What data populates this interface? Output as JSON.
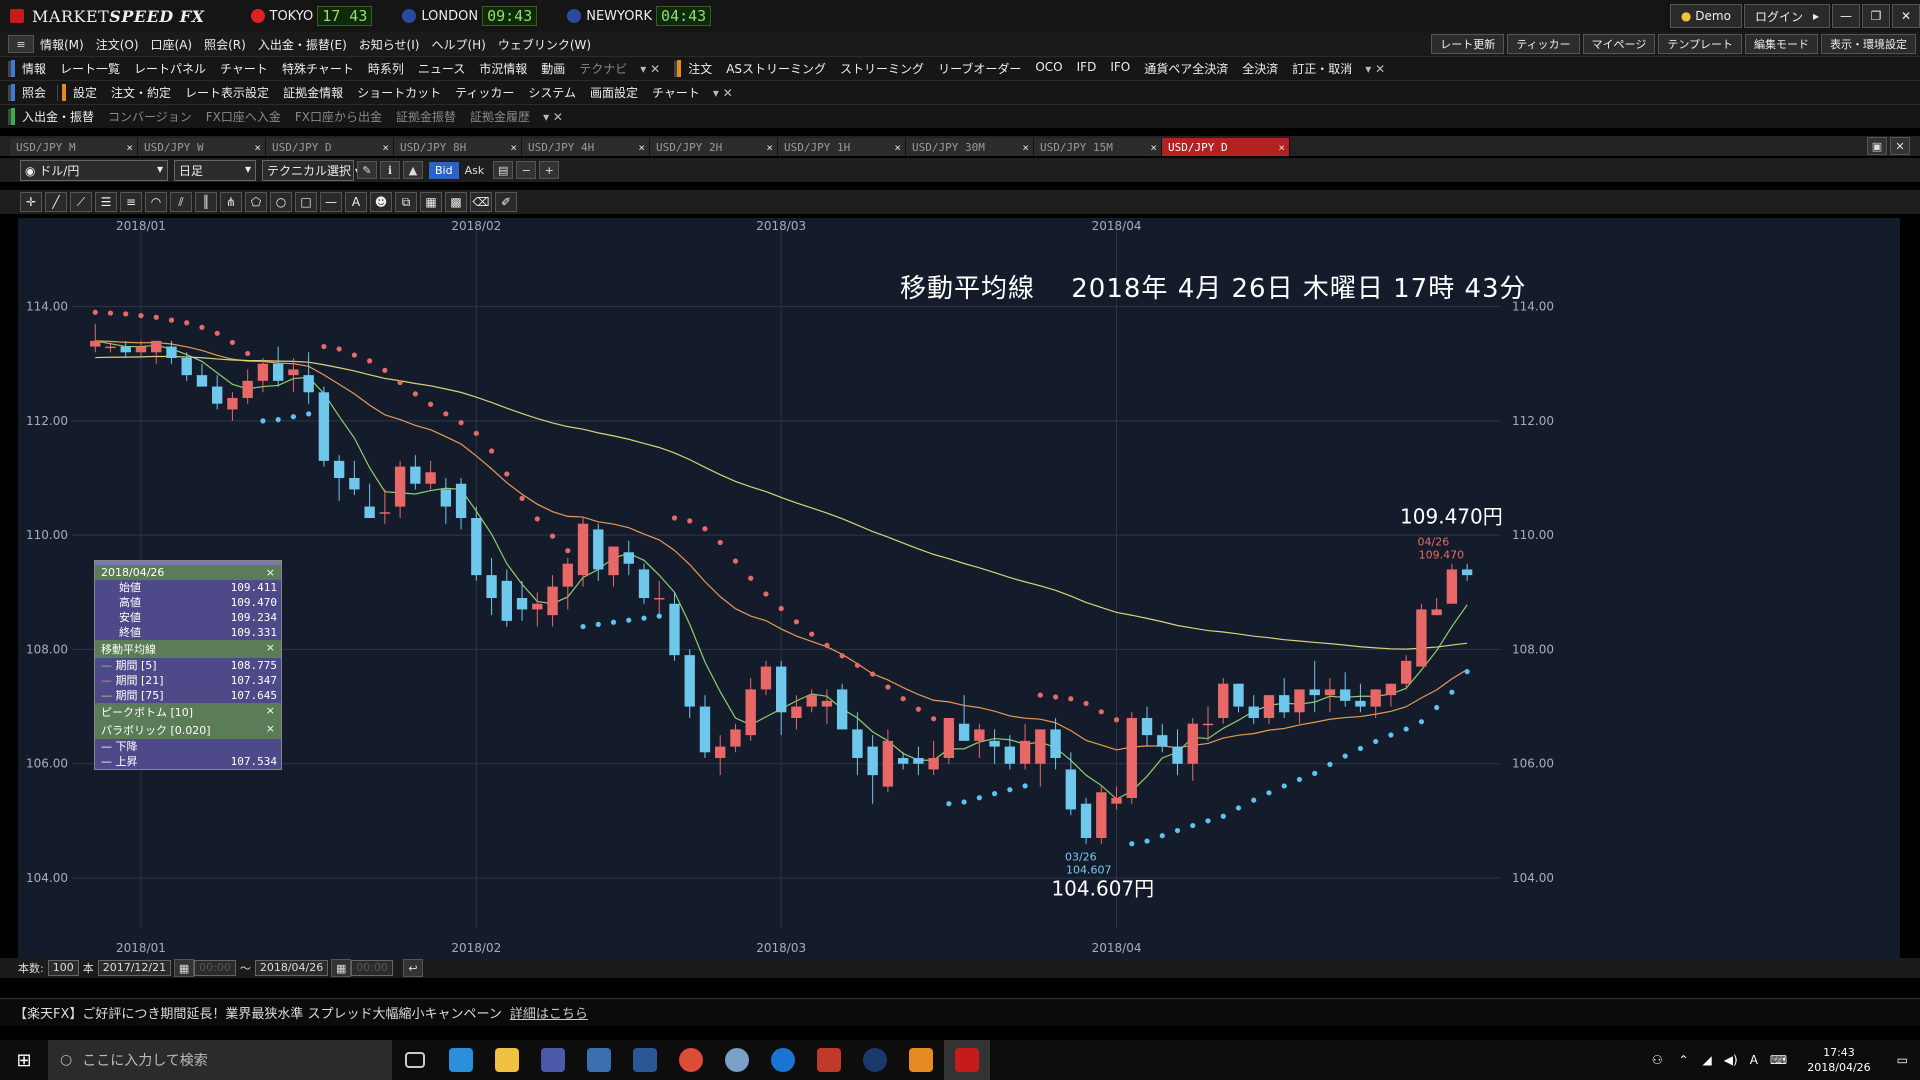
{
  "app": {
    "brand_a": "MARKET",
    "brand_b": "SPEED FX",
    "demo": "Demo",
    "login": "ログイン"
  },
  "clocks": [
    {
      "name": "TOKYO",
      "time": "17 43",
      "flag": "#d22"
    },
    {
      "name": "LONDON",
      "time": "09:43",
      "flag": "#2a4aa0"
    },
    {
      "name": "NEWYORK",
      "time": "04:43",
      "flag": "#2a4aa0"
    }
  ],
  "menu": [
    "情報(M)",
    "注文(O)",
    "口座(A)",
    "照会(R)",
    "入出金・振替(E)",
    "お知らせ(I)",
    "ヘルプ(H)",
    "ウェブリンク(W)"
  ],
  "menu_right": [
    "レート更新",
    "ティッカー",
    "マイページ",
    "テンプレート",
    "編集モード",
    "表示・環境設定"
  ],
  "toolbar1": {
    "section": "情報",
    "items": [
      "レート一覧",
      "レートパネル",
      "チャート",
      "特殊チャート",
      "時系列",
      "ニュース",
      "市況情報",
      "動画",
      "テクナビ"
    ],
    "order_section": "注文",
    "order_items": [
      "ASストリーミング",
      "ストリーミング",
      "リーブオーダー",
      "OCO",
      "IFD",
      "IFO",
      "通貨ペア全決済",
      "全決済",
      "訂正・取消"
    ]
  },
  "toolbar2": {
    "section": "照会",
    "section2": "設定",
    "items": [
      "注文・約定",
      "レート表示設定",
      "証拠金情報",
      "ショートカット",
      "ティッカー",
      "システム",
      "画面設定",
      "チャート"
    ]
  },
  "toolbar3": {
    "section": "入出金・振替",
    "items": [
      "コンバージョン",
      "FX口座へ入金",
      "FX口座から出金",
      "証拠金振替",
      "証拠金履歴"
    ]
  },
  "tabs": [
    "USD/JPY M",
    "USD/JPY W",
    "USD/JPY D",
    "USD/JPY 8H",
    "USD/JPY 4H",
    "USD/JPY 2H",
    "USD/JPY 1H",
    "USD/JPY 30M",
    "USD/JPY 15M",
    "USD/JPY D"
  ],
  "chart_controls": {
    "pair": "ドル/円",
    "period": "日足",
    "tech": "テクニカル選択",
    "bid": "Bid",
    "ask": "Ask"
  },
  "overlay_title": "移動平均線　 2018年 4月 26日 木曜日 17時 43分",
  "info_panel": {
    "date": "2018/04/26",
    "ohlc": [
      {
        "k": "始値",
        "v": "109.411"
      },
      {
        "k": "高値",
        "v": "109.470"
      },
      {
        "k": "安値",
        "v": "109.234"
      },
      {
        "k": "終値",
        "v": "109.331"
      }
    ],
    "ma_header": "移動平均線",
    "ma": [
      {
        "k": "期間 [5]",
        "v": "108.775"
      },
      {
        "k": "期間 [21]",
        "v": "107.347"
      },
      {
        "k": "期間 [75]",
        "v": "107.645"
      }
    ],
    "peak_header": "ピークボトム [10]",
    "sar_header": "パラボリック [0.020]",
    "sar": [
      {
        "k": "下降",
        "v": ""
      },
      {
        "k": "上昇",
        "v": "107.534"
      }
    ]
  },
  "bottom": {
    "count_label": "本数:",
    "count": "100",
    "unit": "本",
    "from": "2017/12/21",
    "from_time": "00:00",
    "tilde": "〜",
    "to": "2018/04/26",
    "to_time": "00:00"
  },
  "news": {
    "text": "【楽天FX】ご好評につき期間延長！業界最狭水準 スプレッド大幅縮小キャンペーン",
    "link": "詳細はこちら"
  },
  "taskbar": {
    "search": "ここに入力して検索",
    "time": "17:43",
    "date": "2018/04/26"
  },
  "chart_data": {
    "type": "candlestick",
    "instrument": "USD/JPY",
    "timeframe": "daily",
    "ylim": [
      103.3,
      115.2
    ],
    "yticks": [
      "104.00",
      "106.00",
      "108.00",
      "110.00",
      "112.00",
      "114.00"
    ],
    "month_labels": [
      {
        "label": "2018/01",
        "index": 3
      },
      {
        "label": "2018/02",
        "index": 25
      },
      {
        "label": "2018/03",
        "index": 45
      },
      {
        "label": "2018/04",
        "index": 67
      }
    ],
    "candles": [
      [
        113.3,
        113.7,
        113.2,
        113.4
      ],
      [
        113.3,
        113.4,
        113.2,
        113.3
      ],
      [
        113.3,
        113.4,
        113.1,
        113.2
      ],
      [
        113.2,
        113.4,
        113.1,
        113.3
      ],
      [
        113.2,
        113.4,
        113.0,
        113.4
      ],
      [
        113.3,
        113.4,
        113.0,
        113.1
      ],
      [
        113.1,
        113.2,
        112.7,
        112.8
      ],
      [
        112.8,
        113.0,
        112.6,
        112.6
      ],
      [
        112.6,
        112.8,
        112.2,
        112.3
      ],
      [
        112.2,
        112.5,
        112.0,
        112.4
      ],
      [
        112.4,
        112.9,
        112.3,
        112.7
      ],
      [
        112.7,
        113.1,
        112.5,
        113.0
      ],
      [
        113.0,
        113.3,
        112.6,
        112.7
      ],
      [
        112.8,
        113.1,
        112.5,
        112.9
      ],
      [
        112.8,
        113.2,
        112.3,
        112.5
      ],
      [
        112.5,
        112.6,
        111.2,
        111.3
      ],
      [
        111.3,
        111.4,
        110.6,
        111.0
      ],
      [
        111.0,
        111.3,
        110.7,
        110.8
      ],
      [
        110.5,
        110.9,
        110.3,
        110.3
      ],
      [
        110.4,
        110.8,
        110.2,
        110.4
      ],
      [
        110.5,
        111.3,
        110.3,
        111.2
      ],
      [
        111.2,
        111.4,
        110.8,
        110.9
      ],
      [
        110.9,
        111.3,
        110.8,
        111.1
      ],
      [
        110.8,
        111.0,
        110.2,
        110.5
      ],
      [
        110.9,
        111.0,
        110.1,
        110.3
      ],
      [
        110.3,
        110.5,
        109.2,
        109.3
      ],
      [
        109.3,
        109.6,
        108.6,
        108.9
      ],
      [
        109.2,
        109.4,
        108.4,
        108.5
      ],
      [
        108.9,
        109.2,
        108.5,
        108.7
      ],
      [
        108.7,
        109.0,
        108.4,
        108.8
      ],
      [
        108.6,
        109.3,
        108.4,
        109.1
      ],
      [
        109.1,
        109.6,
        108.7,
        109.5
      ],
      [
        109.3,
        110.3,
        109.1,
        110.2
      ],
      [
        110.1,
        110.2,
        109.2,
        109.4
      ],
      [
        109.3,
        109.8,
        109.1,
        109.8
      ],
      [
        109.7,
        109.9,
        109.3,
        109.5
      ],
      [
        109.4,
        109.5,
        108.8,
        108.9
      ],
      [
        108.9,
        109.2,
        108.6,
        108.9
      ],
      [
        108.8,
        109.0,
        107.8,
        107.9
      ],
      [
        107.9,
        108.0,
        106.8,
        107.0
      ],
      [
        107.0,
        107.2,
        106.1,
        106.2
      ],
      [
        106.1,
        106.5,
        105.8,
        106.3
      ],
      [
        106.3,
        106.7,
        106.2,
        106.6
      ],
      [
        106.5,
        107.5,
        106.4,
        107.3
      ],
      [
        107.3,
        107.8,
        107.2,
        107.7
      ],
      [
        107.7,
        107.8,
        106.5,
        106.9
      ],
      [
        106.8,
        107.2,
        106.6,
        107.0
      ],
      [
        107.0,
        107.3,
        106.9,
        107.2
      ],
      [
        107.0,
        107.3,
        106.7,
        107.1
      ],
      [
        107.3,
        107.4,
        106.6,
        106.6
      ],
      [
        106.6,
        106.9,
        105.8,
        106.1
      ],
      [
        106.3,
        106.5,
        105.3,
        105.8
      ],
      [
        105.6,
        106.6,
        105.5,
        106.4
      ],
      [
        106.1,
        106.2,
        105.9,
        106.0
      ],
      [
        106.1,
        106.3,
        105.8,
        106.0
      ],
      [
        105.9,
        106.4,
        105.8,
        106.1
      ],
      [
        106.1,
        106.8,
        106.0,
        106.8
      ],
      [
        106.7,
        107.2,
        106.4,
        106.4
      ],
      [
        106.4,
        106.7,
        106.1,
        106.6
      ],
      [
        106.4,
        106.6,
        106.0,
        106.3
      ],
      [
        106.3,
        106.5,
        105.9,
        106.0
      ],
      [
        106.0,
        106.7,
        105.9,
        106.4
      ],
      [
        106.0,
        106.6,
        105.6,
        106.6
      ],
      [
        106.6,
        106.8,
        105.9,
        106.1
      ],
      [
        105.9,
        106.2,
        105.1,
        105.2
      ],
      [
        105.3,
        105.4,
        104.6,
        104.7
      ],
      [
        104.7,
        105.6,
        104.6,
        105.5
      ],
      [
        105.3,
        105.6,
        105.2,
        105.4
      ],
      [
        105.4,
        106.9,
        105.3,
        106.8
      ],
      [
        106.8,
        107.0,
        106.3,
        106.5
      ],
      [
        106.5,
        106.7,
        106.2,
        106.3
      ],
      [
        106.3,
        106.6,
        105.8,
        106.0
      ],
      [
        106.0,
        106.8,
        105.7,
        106.7
      ],
      [
        106.7,
        107.0,
        106.4,
        106.7
      ],
      [
        106.8,
        107.5,
        106.7,
        107.4
      ],
      [
        107.4,
        107.4,
        106.9,
        107.0
      ],
      [
        107.0,
        107.2,
        106.7,
        106.8
      ],
      [
        106.8,
        107.2,
        106.7,
        107.2
      ],
      [
        107.2,
        107.5,
        106.8,
        106.9
      ],
      [
        106.9,
        107.3,
        106.7,
        107.3
      ],
      [
        107.3,
        107.8,
        106.9,
        107.2
      ],
      [
        107.2,
        107.5,
        106.9,
        107.3
      ],
      [
        107.3,
        107.6,
        107.0,
        107.1
      ],
      [
        107.1,
        107.4,
        106.9,
        107.0
      ],
      [
        107.0,
        107.3,
        106.8,
        107.3
      ],
      [
        107.2,
        107.4,
        107.0,
        107.4
      ],
      [
        107.4,
        107.9,
        107.3,
        107.8
      ],
      [
        107.7,
        108.8,
        107.7,
        108.7
      ],
      [
        108.6,
        108.9,
        108.6,
        108.7
      ],
      [
        108.8,
        109.5,
        108.8,
        109.4
      ],
      [
        109.4,
        109.5,
        109.2,
        109.3
      ]
    ],
    "ma_series": [
      {
        "name": "期間 [5]",
        "color": "#8ed06a"
      },
      {
        "name": "期間 [21]",
        "color": "#e59a55"
      },
      {
        "name": "期間 [75]",
        "color": "#d8d27a"
      }
    ],
    "sar_color_up": "#5fc3f0",
    "sar_color_down": "#e66a6a",
    "annotations": [
      {
        "text": "109.470円",
        "sub1": "04/26",
        "sub2": "109.470",
        "value": 109.47,
        "index": 87
      },
      {
        "text": "104.607円",
        "sub1": "03/26",
        "sub2": "104.607",
        "value": 104.607,
        "index": 64
      }
    ],
    "up_color": "#e86868",
    "down_color": "#6fc8ec"
  }
}
